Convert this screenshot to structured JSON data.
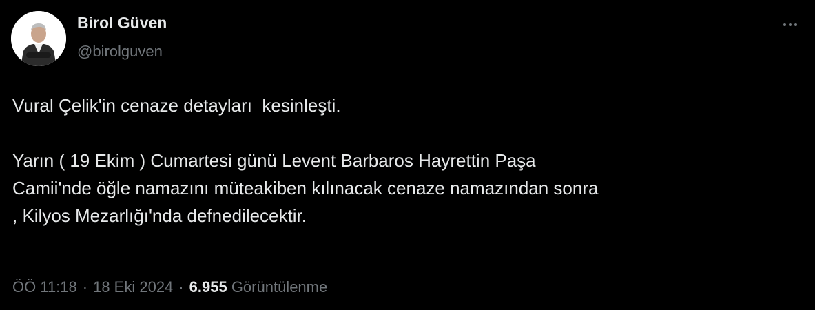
{
  "author": {
    "display_name": "Birol Güven",
    "handle": "@birolguven"
  },
  "more_icon": "more-horizontal-icon",
  "tweet": {
    "text": "Vural Çelik'in cenaze detayları  kesinleşti.\n\nYarın ( 19 Ekim ) Cumartesi günü Levent Barbaros Hayrettin Paşa\nCamii'nde öğle namazını müteakiben kılınacak cenaze namazından sonra\n, Kilyos Mezarlığı'nda defnedilecektir."
  },
  "meta": {
    "time": "ÖÖ 11:18",
    "separator": "·",
    "date": "18 Eki 2024",
    "views_count": "6.955",
    "views_label": "Görüntülenme"
  },
  "colors": {
    "background": "#000000",
    "text": "#e7e9ea",
    "secondary": "#71767b"
  }
}
